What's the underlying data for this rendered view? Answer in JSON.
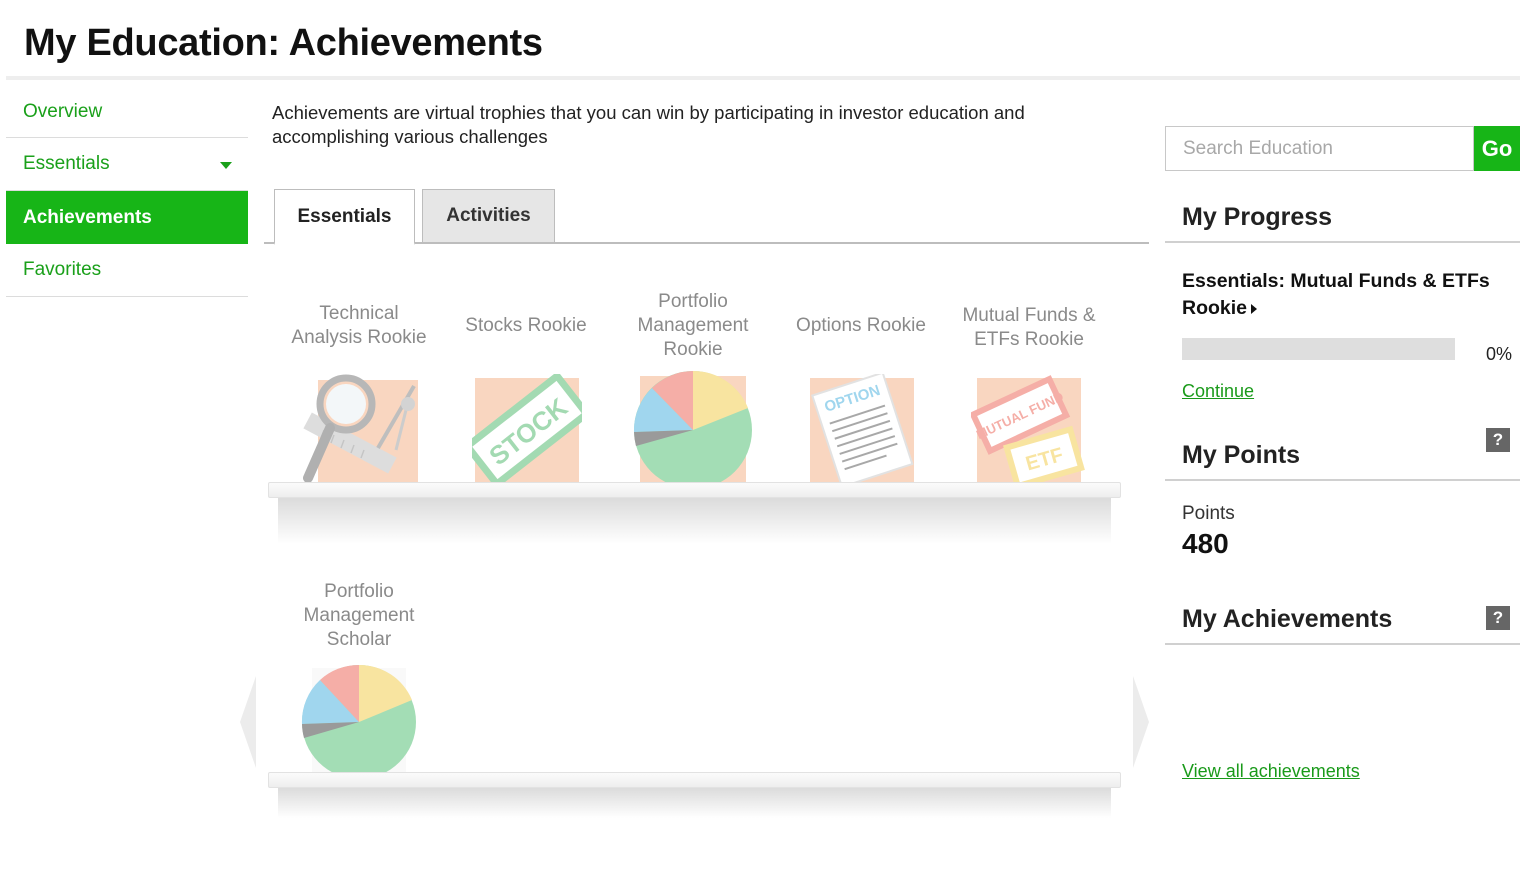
{
  "page": {
    "title": "My Education: Achievements"
  },
  "sidebar": {
    "items": [
      {
        "label": "Overview"
      },
      {
        "label": "Essentials"
      },
      {
        "label": "Achievements"
      },
      {
        "label": "Favorites"
      }
    ]
  },
  "main": {
    "intro": "Achievements are virtual trophies that you can win by participating in investor education and accomplishing various challenges",
    "tabs": [
      {
        "label": "Essentials",
        "selected": true
      },
      {
        "label": "Activities",
        "selected": false
      }
    ],
    "achievements": [
      {
        "label": "Technical Analysis Rookie",
        "icon": "magnifier-ruler-icon"
      },
      {
        "label": "Stocks Rookie",
        "icon": "stock-stamp-icon"
      },
      {
        "label": "Portfolio Management Rookie",
        "icon": "pie-chart-icon"
      },
      {
        "label": "Options Rookie",
        "icon": "option-document-icon"
      },
      {
        "label": "Mutual Funds & ETFs Rookie",
        "icon": "mutual-fund-etf-stamp-icon"
      },
      {
        "label": "Portfolio Management Scholar",
        "icon": "pie-chart-icon"
      }
    ],
    "stamp_texts": {
      "stock": "STOCK",
      "option": "OPTION",
      "mutual_fund": "MUTUAL FUND",
      "etf": "ETF"
    }
  },
  "right": {
    "search": {
      "placeholder": "Search Education",
      "button_label": "Go"
    },
    "progress": {
      "title": "My Progress",
      "course": "Essentials: Mutual Funds & ETFs Rookie",
      "percent": 0,
      "percent_label": "0%",
      "continue_label": "Continue"
    },
    "points": {
      "title": "My Points",
      "label": "Points",
      "value": "480",
      "help_label": "?"
    },
    "achievements": {
      "title": "My Achievements",
      "help_label": "?",
      "view_all_label": "View all achievements"
    }
  },
  "colors": {
    "brand_green": "#17b517",
    "link_green": "#1a9a1a",
    "muted_text": "#8a8a8a",
    "help_gray": "#666666"
  }
}
